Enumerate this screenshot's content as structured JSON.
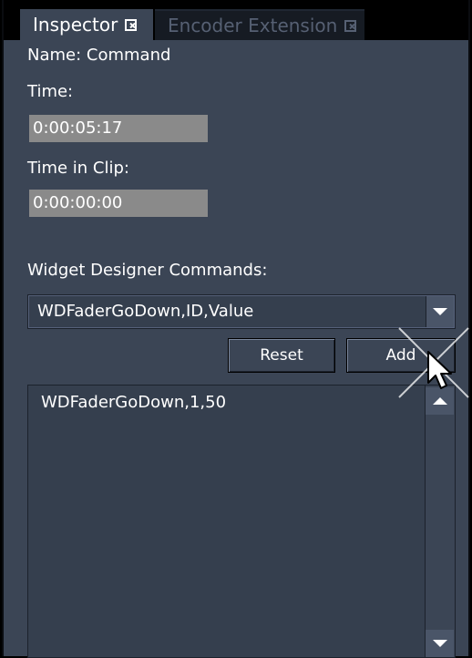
{
  "tabs": [
    {
      "label": "Inspector",
      "active": true
    },
    {
      "label": "Encoder Extension",
      "active": false
    }
  ],
  "fields": {
    "name_label": "Name: Command",
    "time_label": "Time:",
    "time_value": "0:00:05:17",
    "time_in_clip_label": "Time in Clip:",
    "time_in_clip_value": "0:00:00:00"
  },
  "commands": {
    "label": "Widget Designer Commands:",
    "selected": "WDFaderGoDown,ID,Value",
    "reset_label": "Reset",
    "add_label": "Add",
    "list_items": [
      "WDFaderGoDown,1,50"
    ]
  },
  "colors": {
    "panel_bg": "#3b4555",
    "field_bg": "#8a8a8a",
    "list_bg": "#353f4e"
  }
}
